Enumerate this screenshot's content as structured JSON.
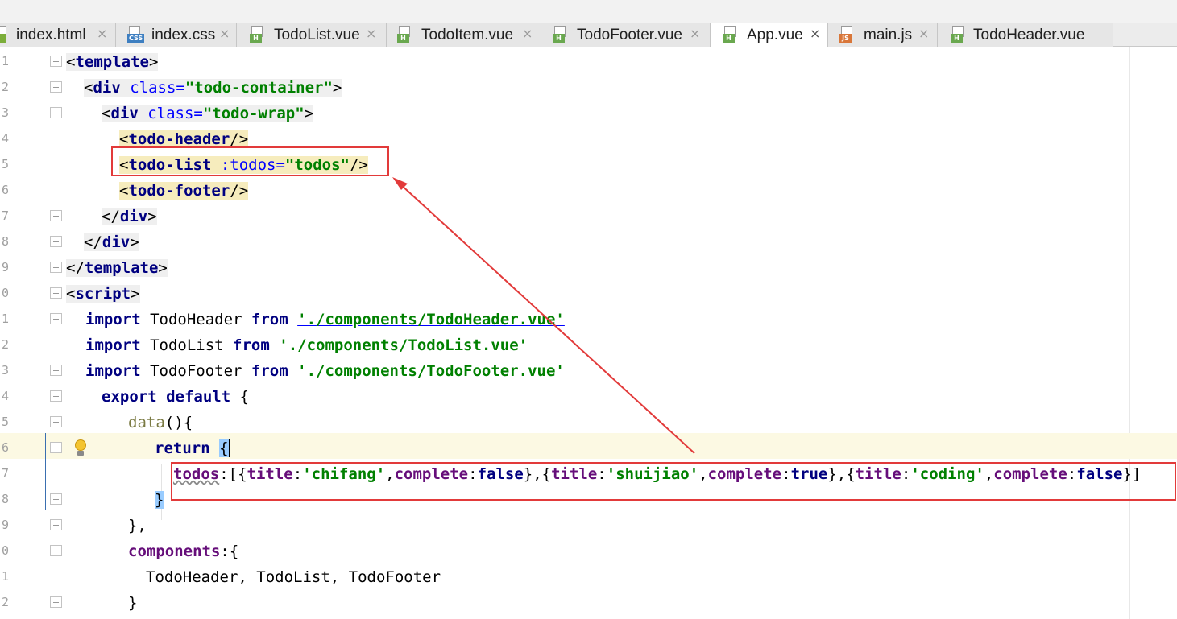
{
  "tabs": [
    {
      "label": "index.html",
      "icon": "html-file-icon",
      "badge": "",
      "active": false
    },
    {
      "label": "index.css",
      "icon": "css-file-icon",
      "badge": "CSS",
      "active": false
    },
    {
      "label": "TodoList.vue",
      "icon": "vue-file-icon",
      "badge": "H",
      "active": false
    },
    {
      "label": "TodoItem.vue",
      "icon": "vue-file-icon",
      "badge": "H",
      "active": false
    },
    {
      "label": "TodoFooter.vue",
      "icon": "vue-file-icon",
      "badge": "H",
      "active": false
    },
    {
      "label": "App.vue",
      "icon": "vue-file-icon",
      "badge": "H",
      "active": true
    },
    {
      "label": "main.js",
      "icon": "js-file-icon",
      "badge": "JS",
      "active": false
    },
    {
      "label": "TodoHeader.vue",
      "icon": "vue-file-icon",
      "badge": "H",
      "active": false
    }
  ],
  "tab_close_glyph": "×",
  "line_numbers": [
    "1",
    "2",
    "3",
    "4",
    "5",
    "6",
    "7",
    "8",
    "9",
    "0",
    "1",
    "2",
    "3",
    "4",
    "5",
    "6",
    "7",
    "8",
    "9",
    "0",
    "1",
    "2"
  ],
  "code": {
    "l1": {
      "open": "<",
      "name": "template",
      "close": ">"
    },
    "l2": {
      "open": "<",
      "name": "div",
      "attr": " class=",
      "value": "\"todo-container\"",
      "close": ">"
    },
    "l3": {
      "open": "<",
      "name": "div",
      "attr": " class=",
      "value": "\"todo-wrap\"",
      "close": ">"
    },
    "l4": {
      "open": "<",
      "name": "todo-header",
      "close": "/>"
    },
    "l5": {
      "open": "<",
      "name": "todo-list",
      "attr": " :todos=",
      "value": "\"todos\"",
      "close": "/>"
    },
    "l6": {
      "open": "<",
      "name": "todo-footer",
      "close": "/>"
    },
    "l7": {
      "open": "</",
      "name": "div",
      "close": ">"
    },
    "l8": {
      "open": "</",
      "name": "div",
      "close": ">"
    },
    "l9": {
      "open": "</",
      "name": "template",
      "close": ">"
    },
    "l10": {
      "open": "<",
      "name": "script",
      "close": ">"
    },
    "l11": {
      "kw1": "import",
      "ident": " TodoHeader ",
      "kw2": "from",
      "path": "'./components/TodoHeader.vue'"
    },
    "l12": {
      "kw1": "import",
      "ident": " TodoList ",
      "kw2": "from",
      "path": "'./components/TodoList.vue'"
    },
    "l13": {
      "kw1": "import",
      "ident": " TodoFooter ",
      "kw2": "from",
      "path": "'./components/TodoFooter.vue'"
    },
    "l14": {
      "kw1": "export",
      "kw2": " default",
      "rest": " {"
    },
    "l15": {
      "fn": "data",
      "rest": "(){"
    },
    "l16": {
      "kw": "return",
      "brace": "{"
    },
    "l17": {
      "todos": "todos",
      "open": ":[{",
      "items": [
        {
          "title": "'chifang'",
          "complete": "false"
        },
        {
          "title": "'shuijiao'",
          "complete": "true"
        },
        {
          "title": "'coding'",
          "complete": "false"
        }
      ],
      "title_key": "title",
      "complete_key": "complete",
      "close": "]"
    },
    "l18": {
      "brace": "}"
    },
    "l19": {
      "text": "},"
    },
    "l20": {
      "prop": "components",
      "rest": ":{"
    },
    "l21": {
      "text": "TodoHeader, TodoList, TodoFooter"
    },
    "l22": {
      "text": "}"
    }
  },
  "colors": {
    "annotation_red": "#e23a3a",
    "tag_name": "#000080",
    "attr_name": "#0000ff",
    "string": "#008000",
    "property": "#660e7a",
    "caret_row": "#fcf9e3"
  }
}
